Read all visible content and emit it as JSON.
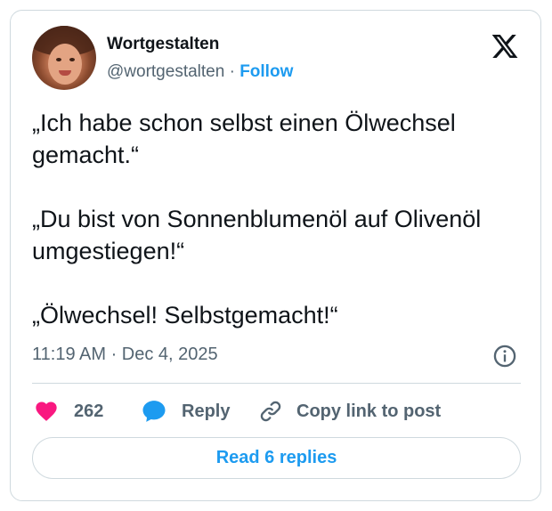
{
  "author": {
    "display_name": "Wortgestalten",
    "handle": "@wortgestalten",
    "separator": "·",
    "follow_label": "Follow"
  },
  "tweet": {
    "paragraphs": [
      "„Ich habe schon selbst einen Ölwechsel gemacht.“",
      "„Du bist von Sonnenblumenöl auf Olivenöl umgestiegen!“",
      "„Ölwechsel! Selbstgemacht!“"
    ],
    "timestamp": "11:19 AM · Dec 4, 2025"
  },
  "actions": {
    "like_count": "262",
    "reply_label": "Reply",
    "copy_label": "Copy link to post"
  },
  "footer": {
    "read_replies_label": "Read 6 replies"
  },
  "icons": {
    "brand": "x-logo-icon",
    "info": "info-icon",
    "like": "heart-icon",
    "reply": "speech-bubble-icon",
    "copy": "link-icon"
  },
  "colors": {
    "accent": "#1d9bf0",
    "like": "#f91880",
    "text": "#0f1419",
    "muted": "#536471",
    "border": "#cfd9de"
  }
}
